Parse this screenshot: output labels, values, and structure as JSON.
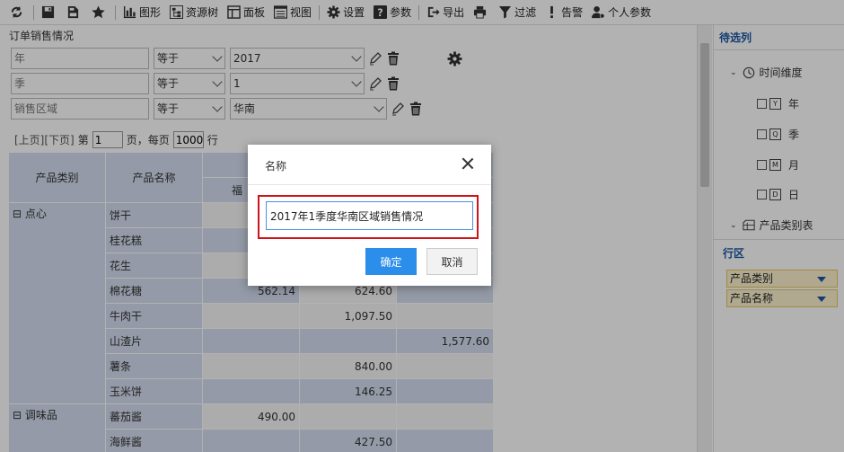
{
  "toolbar": {
    "items": [
      {
        "label": ""
      },
      {
        "label": ""
      },
      {
        "label": ""
      },
      {
        "label": ""
      },
      {
        "label": "图形"
      },
      {
        "label": "资源树"
      },
      {
        "label": "面板"
      },
      {
        "label": "视图"
      },
      {
        "label": "设置"
      },
      {
        "label": "参数"
      },
      {
        "label": "导出"
      },
      {
        "label": ""
      },
      {
        "label": "过滤"
      },
      {
        "label": "告警"
      },
      {
        "label": "个人参数"
      }
    ]
  },
  "report": {
    "title": "订单销售情况"
  },
  "filters": [
    {
      "field": "年",
      "operator": "等于",
      "value": "2017"
    },
    {
      "field": "季",
      "operator": "等于",
      "value": "1"
    },
    {
      "field": "销售区域",
      "operator": "等于",
      "value": "华南"
    }
  ],
  "pager": {
    "prev": "[上页]",
    "next": "[下页]",
    "page_prefix": "第",
    "page_value": "1",
    "page_suffix": "页，每页",
    "per_page_value": "1000",
    "per_page_suffix": "行"
  },
  "table": {
    "headers": {
      "category": "产品类别",
      "name": "产品名称",
      "sub1": "福"
    },
    "rows": [
      {
        "category": "⊟ 点心",
        "name": "饼干",
        "v1": "",
        "v2": "",
        "v3": ""
      },
      {
        "category": "",
        "name": "桂花糕",
        "v1": "",
        "v2": "",
        "v3": ""
      },
      {
        "category": "",
        "name": "花生",
        "v1": "",
        "v2": "",
        "v3": ""
      },
      {
        "category": "",
        "name": "棉花糖",
        "v1": "562.14",
        "v2": "624.60",
        "v3": ""
      },
      {
        "category": "",
        "name": "牛肉干",
        "v1": "",
        "v2": "1,097.50",
        "v3": ""
      },
      {
        "category": "",
        "name": "山渣片",
        "v1": "",
        "v2": "",
        "v3": "1,577.60"
      },
      {
        "category": "",
        "name": "薯条",
        "v1": "",
        "v2": "840.00",
        "v3": ""
      },
      {
        "category": "",
        "name": "玉米饼",
        "v1": "",
        "v2": "146.25",
        "v3": ""
      },
      {
        "category": "⊟ 调味品",
        "name": "蕃茄酱",
        "v1": "490.00",
        "v2": "",
        "v3": ""
      },
      {
        "category": "",
        "name": "海鲜酱",
        "v1": "",
        "v2": "427.50",
        "v3": ""
      }
    ]
  },
  "right_panel": {
    "pending_title": "待选列",
    "time_dim": "时间维度",
    "year": "年",
    "quarter": "季",
    "month": "月",
    "day": "日",
    "product_table": "产品类别表",
    "row_zone_title": "行区",
    "row_zone_items": [
      "产品类别",
      "产品名称"
    ],
    "cal_y": "Y",
    "cal_q": "Q",
    "cal_m": "M",
    "cal_d": "D"
  },
  "dialog": {
    "title": "名称",
    "name_value": "2017年1季度华南区域销售情况",
    "ok_label": "确定",
    "cancel_label": "取消"
  },
  "colors": {
    "accent": "#2b8eea",
    "highlight_border": "#d0121b",
    "header_blue": "#d5ddf0",
    "panel_title": "#1a56a4"
  }
}
